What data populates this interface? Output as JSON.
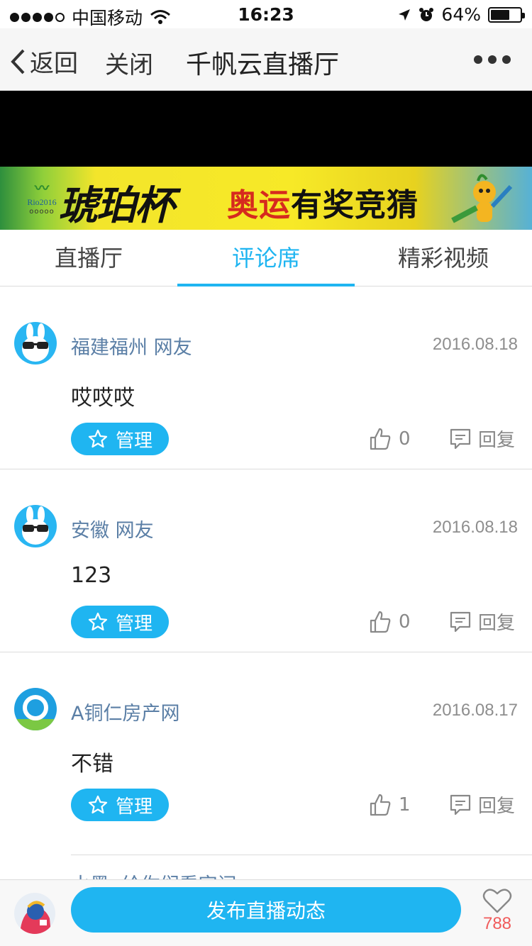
{
  "status_bar": {
    "carrier": "中国移动",
    "time": "16:23",
    "battery": "64%",
    "battery_level": 0.64
  },
  "nav": {
    "back_label": "返回",
    "close_label": "关闭",
    "title": "千帆云直播厅"
  },
  "banner": {
    "rio_text": "Rio2016",
    "brush_text": "琥珀杯",
    "slogan_red": "奥运",
    "slogan_black": "有奖竞猜"
  },
  "tabs": [
    {
      "label": "直播厅"
    },
    {
      "label": "评论席"
    },
    {
      "label": "精彩视频"
    }
  ],
  "active_tab": "评论席",
  "comments": [
    {
      "user": "福建福州 网友",
      "date": "2016.08.18",
      "content": "哎哎哎",
      "manage": "管理",
      "likes": "0",
      "reply": "回复",
      "avatar": "rabbit-icon"
    },
    {
      "user": "安徽 网友",
      "date": "2016.08.18",
      "content": "123",
      "manage": "管理",
      "likes": "0",
      "reply": "回复",
      "avatar": "rabbit-icon"
    },
    {
      "user": "A铜仁房产网",
      "date": "2016.08.17",
      "content": "不错",
      "manage": "管理",
      "likes": "1",
      "reply": "回复",
      "avatar": "ring-logo-icon"
    }
  ],
  "partial_comment_user": "水墨 :给你们看字问",
  "bottom": {
    "publish_label": "发布直播动态",
    "heart_count": "788"
  },
  "colors": {
    "accent": "#1fb5f1",
    "username": "#5b7fa6",
    "heart_count": "#f05b5b"
  }
}
